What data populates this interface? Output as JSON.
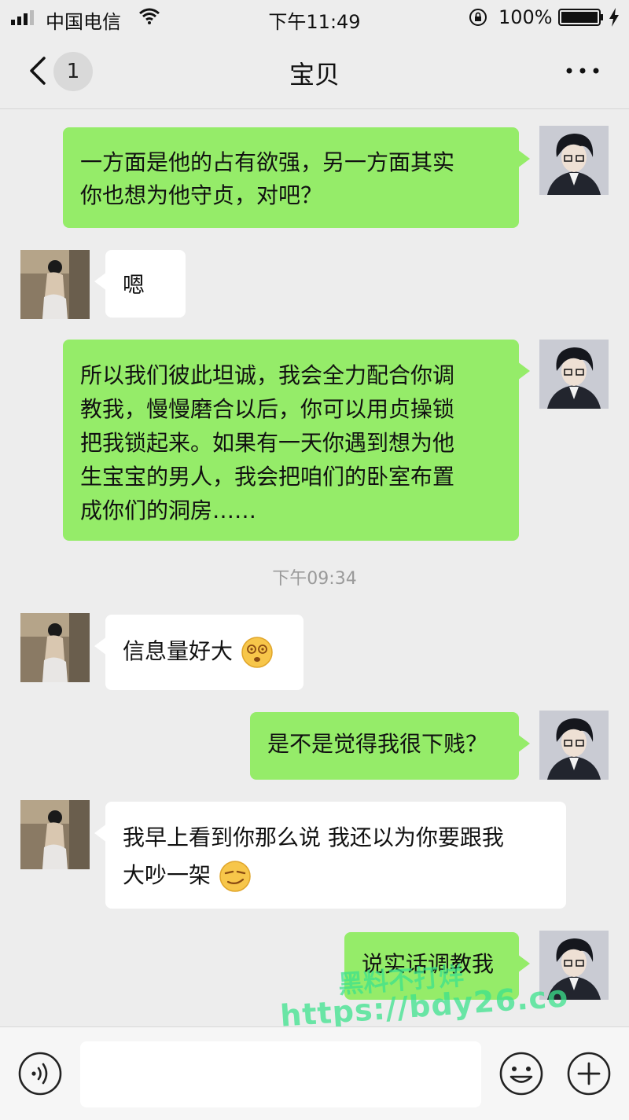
{
  "status_bar": {
    "carrier": "中国电信",
    "time": "下午11:49",
    "battery": "100%"
  },
  "nav": {
    "unread_count": "1",
    "title": "宝贝"
  },
  "messages": [
    {
      "side": "out",
      "text": "一方面是他的占有欲强，另一方面其实\n你也想为他守贞，对吧？"
    },
    {
      "side": "in",
      "text": "嗯"
    },
    {
      "side": "out",
      "text": "所以我们彼此坦诚，我会全力配合你调\n教我，慢慢磨合以后，你可以用贞操锁\n把我锁起来。如果有一天你遇到想为他\n生宝宝的男人，我会把咱们的卧室布置\n成你们的洞房……"
    },
    {
      "side": "in",
      "text": "信息量好大",
      "emoji": "dizzy-face-emoji"
    },
    {
      "side": "out",
      "text": "是不是觉得我很下贱？"
    },
    {
      "side": "in",
      "text": "我早上看到你那么说 我还以为你要跟我\n大吵一架",
      "emoji": "smirk-face-emoji"
    },
    {
      "side": "out",
      "text": "说实话调教我"
    }
  ],
  "timestamp": "下午09:34",
  "watermark": {
    "line1": "黑料不打烊",
    "line2": "https://bdy26.co"
  },
  "colors": {
    "outgoing_bubble": "#95ec69",
    "incoming_bubble": "#ffffff",
    "background": "#ededed"
  }
}
